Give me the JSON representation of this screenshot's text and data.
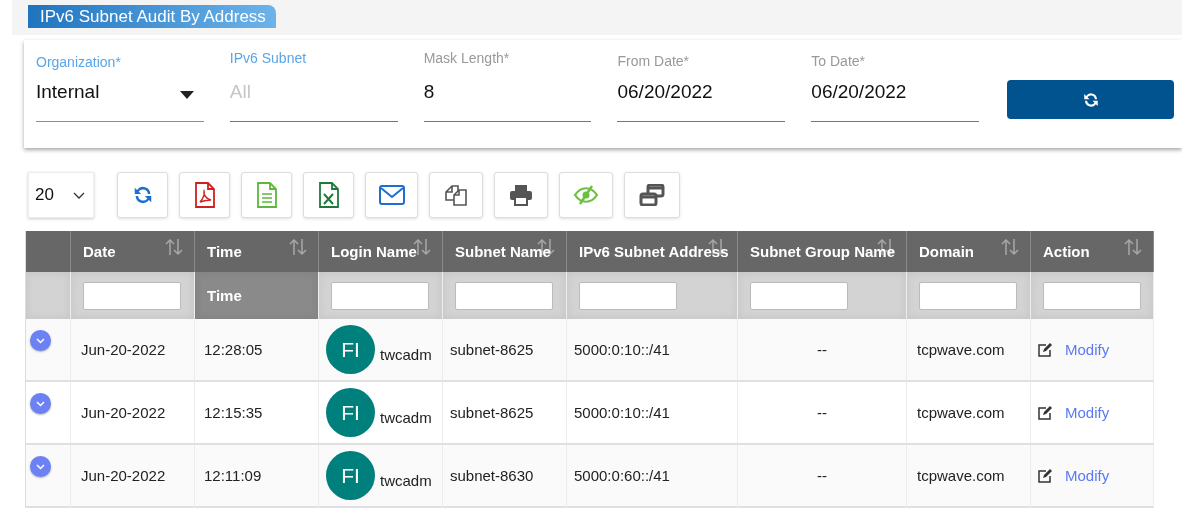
{
  "header": {
    "title": "IPv6 Subnet Audit By Address"
  },
  "filters": {
    "fields": [
      {
        "kind": "select",
        "label": "Organization*",
        "value": "Internal",
        "focused": true,
        "label_highlighted": true
      },
      {
        "kind": "input",
        "label": "IPv6 Subnet",
        "placeholder": "All",
        "focused": false,
        "label_highlighted": true
      },
      {
        "kind": "input",
        "label": "Mask Length*",
        "value": "8",
        "focused": false,
        "label_highlighted": false
      },
      {
        "kind": "input",
        "label": "From Date*",
        "value": "06/20/2022",
        "focused": false,
        "label_highlighted": false
      },
      {
        "kind": "input",
        "label": "To Date*",
        "value": "06/20/2022",
        "focused": false,
        "label_highlighted": false
      }
    ]
  },
  "toolbar": {
    "page_size": "20"
  },
  "table": {
    "columns": [
      "Date",
      "Time",
      "Login Name",
      "Subnet Name",
      "IPv6 Subnet Address",
      "Subnet Group Name",
      "Domain",
      "Action"
    ],
    "filters": [
      {
        "kind": "input"
      },
      {
        "kind": "label",
        "text": "Time"
      },
      {
        "kind": "input"
      },
      {
        "kind": "input"
      },
      {
        "kind": "input"
      },
      {
        "kind": "input"
      },
      {
        "kind": "input"
      },
      {
        "kind": "input"
      }
    ],
    "rows": [
      {
        "expanded": false,
        "date": "Jun-20-2022",
        "time": "12:28:05",
        "avatar": "FI",
        "login": "twcadm",
        "subnet": "subnet-8625",
        "address": "5000:0:10::/41",
        "group": "--",
        "domain": "tcpwave.com",
        "action": "Modify"
      },
      {
        "expanded": false,
        "date": "Jun-20-2022",
        "time": "12:15:35",
        "avatar": "FI",
        "login": "twcadm",
        "subnet": "subnet-8625",
        "address": "5000:0:10::/41",
        "group": "--",
        "domain": "tcpwave.com",
        "action": "Modify"
      },
      {
        "expanded": false,
        "date": "Jun-20-2022",
        "time": "12:11:09",
        "avatar": "FI",
        "login": "twcadm",
        "subnet": "subnet-8630",
        "address": "5000:0:60::/41",
        "group": "--",
        "domain": "tcpwave.com",
        "action": "Modify"
      }
    ]
  }
}
